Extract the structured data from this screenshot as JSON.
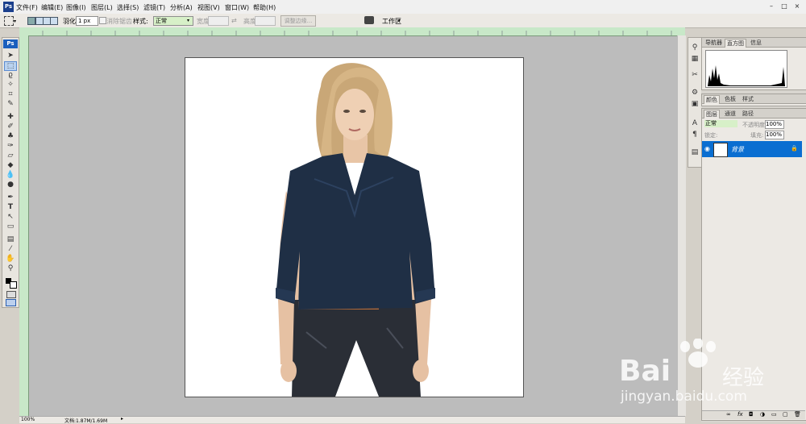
{
  "menubar": {
    "app_icon": "Ps",
    "items": [
      "文件(F)",
      "编辑(E)",
      "图像(I)",
      "图层(L)",
      "选择(S)",
      "滤镜(T)",
      "分析(A)",
      "视图(V)",
      "窗口(W)",
      "帮助(H)"
    ],
    "window_buttons": [
      "–",
      "□",
      "×"
    ]
  },
  "options_bar": {
    "feather_label": "羽化:",
    "feather_value": "1 px",
    "antialias_label": "消除锯齿",
    "style_label": "样式:",
    "style_value": "正常",
    "width_label": "宽度:",
    "height_label": "高度:",
    "refine_edge_label": "调整边缘...",
    "workspace_label": "工作区"
  },
  "toolbox": {
    "badge": "Ps",
    "tools": [
      "move-tool",
      "marquee-tool",
      "lasso-tool",
      "magic-wand-tool",
      "crop-tool",
      "slice-tool",
      "healing-brush-tool",
      "brush-tool",
      "clone-stamp-tool",
      "history-brush-tool",
      "eraser-tool",
      "paint-bucket-tool",
      "blur-tool",
      "dodge-tool",
      "pen-tool",
      "type-tool",
      "path-selection-tool",
      "shape-tool",
      "notes-tool",
      "eyedropper-tool",
      "hand-tool",
      "zoom-tool"
    ],
    "selected_tool": "marquee-tool"
  },
  "status_bar": {
    "zoom": "100%",
    "doc_info": "文档:1.87M/1.69M"
  },
  "panels": {
    "top_tabs": [
      "导航器",
      "直方图",
      "信息"
    ],
    "top_active": "直方图",
    "mid_tabs": [
      "颜色",
      "色板",
      "样式"
    ],
    "layer_tabs": [
      "图层",
      "通道",
      "路径"
    ],
    "blend_mode": "正常",
    "opacity_label": "不透明度:",
    "opacity_value": "100%",
    "lock_label": "锁定:",
    "fill_label": "填充:",
    "fill_value": "100%",
    "layer_name": "背景"
  },
  "colors": {
    "accent": "#0a6ed1",
    "ruler": "#c8e8c8",
    "canvas_bg": "#bcbcbc",
    "shirt": "#1f2f45"
  },
  "watermark": {
    "logo_text": "Bai",
    "brand": "经验",
    "url": "jingyan.baidu.com"
  }
}
